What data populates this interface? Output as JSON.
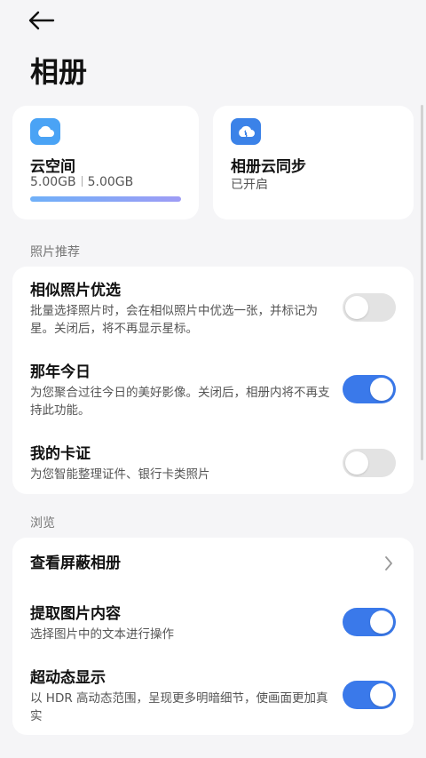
{
  "header": {
    "title": "相册"
  },
  "cloud_space": {
    "title": "云空间",
    "used": "5.00GB",
    "total": "5.00GB",
    "usage_fraction": 1.0
  },
  "cloud_sync": {
    "title": "相册云同步",
    "status": "已开启"
  },
  "photo_recommend": {
    "label": "照片推荐",
    "items": [
      {
        "title": "相似照片优选",
        "desc": "批量选择照片时，会在相似照片中优选一张，并标记为星。关闭后，将不再显示星标。",
        "enabled": false
      },
      {
        "title": "那年今日",
        "desc": "为您聚合过往今日的美好影像。关闭后，相册内将不再支持此功能。",
        "enabled": true
      },
      {
        "title": "我的卡证",
        "desc": "为您智能整理证件、银行卡类照片",
        "enabled": false
      }
    ]
  },
  "browse": {
    "label": "浏览",
    "hidden_album": {
      "title": "查看屏蔽相册"
    },
    "items": [
      {
        "title": "提取图片内容",
        "desc": "选择图片中的文本进行操作",
        "enabled": true
      },
      {
        "title": "超动态显示",
        "desc": "以 HDR 高动态范围，呈现更多明暗细节，使画面更加真实",
        "enabled": true
      }
    ]
  },
  "colors": {
    "accent": "#3a79ea",
    "background": "#f5f5f7"
  }
}
